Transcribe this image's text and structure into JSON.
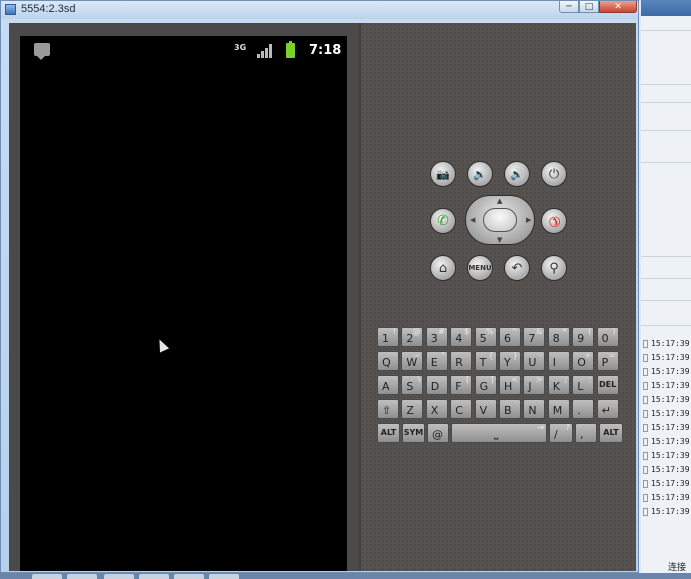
{
  "window": {
    "title": "5554:2.3sd",
    "minimize": "─",
    "maximize": "□",
    "close": "✕"
  },
  "statusbar": {
    "network": "3G",
    "time": "7:18"
  },
  "controls": {
    "menu_label": "MENU",
    "icons": {
      "camera": "📷",
      "vol_down": "🔉",
      "vol_up": "🔊",
      "power": "⏻",
      "call": "✆",
      "end": "✆",
      "home": "⌂",
      "back": "↶",
      "search": "⚲"
    }
  },
  "keyboard": {
    "row1": [
      {
        "k": "1",
        "a": "!"
      },
      {
        "k": "2",
        "a": "@"
      },
      {
        "k": "3",
        "a": "#"
      },
      {
        "k": "4",
        "a": "$"
      },
      {
        "k": "5",
        "a": "%"
      },
      {
        "k": "6",
        "a": "^"
      },
      {
        "k": "7",
        "a": "&"
      },
      {
        "k": "8",
        "a": "*"
      },
      {
        "k": "9",
        "a": "("
      },
      {
        "k": "0",
        "a": ")"
      }
    ],
    "row2": [
      {
        "k": "Q",
        "a": ""
      },
      {
        "k": "W",
        "a": "~"
      },
      {
        "k": "E",
        "a": "\""
      },
      {
        "k": "R",
        "a": ""
      },
      {
        "k": "T",
        "a": "{"
      },
      {
        "k": "Y",
        "a": "}"
      },
      {
        "k": "U",
        "a": "-"
      },
      {
        "k": "I",
        "a": ""
      },
      {
        "k": "O",
        "a": "+"
      },
      {
        "k": "P",
        "a": "="
      }
    ],
    "row3": [
      {
        "k": "A",
        "a": ""
      },
      {
        "k": "S",
        "a": "\\"
      },
      {
        "k": "D",
        "a": ""
      },
      {
        "k": "F",
        "a": "["
      },
      {
        "k": "G",
        "a": "]"
      },
      {
        "k": "H",
        "a": "<"
      },
      {
        "k": "J",
        "a": ">"
      },
      {
        "k": "K",
        "a": ";"
      },
      {
        "k": "L",
        "a": ":"
      },
      {
        "k": "DEL",
        "a": ""
      }
    ],
    "row4": [
      {
        "k": "⇧",
        "a": ""
      },
      {
        "k": "Z",
        "a": ""
      },
      {
        "k": "X",
        "a": ""
      },
      {
        "k": "C",
        "a": ""
      },
      {
        "k": "V",
        "a": ""
      },
      {
        "k": "B",
        "a": ""
      },
      {
        "k": "N",
        "a": ""
      },
      {
        "k": "M",
        "a": ""
      },
      {
        "k": ".",
        "a": ""
      },
      {
        "k": "↵",
        "a": ""
      }
    ],
    "row5": {
      "alt_left": "ALT",
      "sym": "SYM",
      "at": "@",
      "space": "⎵",
      "tab": "⇥",
      "slash": "/",
      "question": "?",
      "comma": ",",
      "alt_right": "ALT"
    }
  },
  "log": {
    "times": [
      "15:17:39",
      "15:17:39",
      "15:17:39",
      "15:17:39",
      "15:17:39",
      "15:17:39",
      "15:17:39",
      "15:17:39",
      "15:17:39",
      "15:17:39",
      "15:17:39",
      "15:17:39",
      "15:17:39"
    ],
    "status": "连接"
  }
}
